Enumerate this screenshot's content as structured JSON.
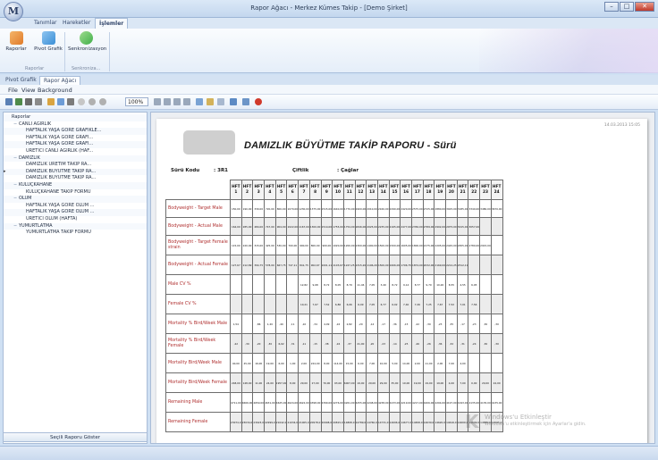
{
  "app": {
    "orb_letter": "M",
    "window_title": "Rapor Ağacı - Merkez Kümes Takip - [Demo Şirket]",
    "win_minimize": "–",
    "win_maximize": "□",
    "win_close": "✕"
  },
  "ribbon": {
    "tabs": [
      {
        "label": "Tanımlar"
      },
      {
        "label": "Hareketler"
      },
      {
        "label": "İşlemler"
      }
    ],
    "buttons": [
      {
        "label": "Raporlar",
        "icon": "report-icon",
        "color": "#e07b2a"
      },
      {
        "label": "Pivot Grafik",
        "icon": "pivot-chart-icon",
        "color": "#3b8fd6"
      },
      {
        "label": "Senkronizasyon",
        "icon": "sync-icon",
        "color": "#3fae49"
      }
    ],
    "groups": [
      {
        "label": "Raporlar"
      },
      {
        "label": "Senkroniza..."
      }
    ]
  },
  "workspace_tabs": [
    {
      "label": "Pivot Grafik"
    },
    {
      "label": "Rapor Ağacı"
    }
  ],
  "menu": {
    "items": [
      {
        "label": "File"
      },
      {
        "label": "View"
      },
      {
        "label": "Background"
      }
    ]
  },
  "toolbar": {
    "zoom_value": "100%"
  },
  "tree": {
    "items": [
      {
        "label": "Raporlar",
        "level": 0,
        "toggle": ""
      },
      {
        "label": "CANLI AĞIRLIK",
        "level": 1,
        "toggle": "−"
      },
      {
        "label": "HAFTALIK YAŞA GÖRE GRAFİKLE...",
        "level": 2,
        "toggle": ""
      },
      {
        "label": "HAFTALIK YAŞA GÖRE GRAFİ...",
        "level": 2,
        "toggle": ""
      },
      {
        "label": "HAFTALIK YAŞA GÖRE GRAFİ...",
        "level": 2,
        "toggle": ""
      },
      {
        "label": "ÜRETİCİ CANLI AĞIRLIK (HAF...",
        "level": 2,
        "toggle": ""
      },
      {
        "label": "DAMIZLIK",
        "level": 1,
        "toggle": "−"
      },
      {
        "label": "DAMIZLIK ÜRETİM TAKİP RA...",
        "level": 2,
        "toggle": ""
      },
      {
        "label": "DAMIZLIK BÜYÜTME TAKİP RA...",
        "level": 2,
        "toggle": ""
      },
      {
        "label": "DAMIZLIK BÜYÜTME TAKİP RA...",
        "level": 2,
        "toggle": ""
      },
      {
        "label": "KULUÇKAHANE",
        "level": 1,
        "toggle": "−"
      },
      {
        "label": "KULUÇKAHANE TAKİP FORMU",
        "level": 2,
        "toggle": ""
      },
      {
        "label": "ÖLÜM",
        "level": 1,
        "toggle": "−"
      },
      {
        "label": "HAFTALIK YAŞA GÖRE ÖLÜM ...",
        "level": 2,
        "toggle": ""
      },
      {
        "label": "HAFTALIK YAŞA GÖRE ÖLÜM ...",
        "level": 2,
        "toggle": ""
      },
      {
        "label": "ÜRETİCİ ÖLÜM (HAFTA)",
        "level": 2,
        "toggle": ""
      },
      {
        "label": "YUMURTLATMA",
        "level": 1,
        "toggle": "−"
      },
      {
        "label": "YUMURTLATMA TAKİP FORMU",
        "level": 2,
        "toggle": ""
      }
    ],
    "row_marker": "▸",
    "show_button": "Seçili Raporu Göster"
  },
  "report": {
    "print_date": "14.03.2013 15:05",
    "title": "DAMIZLIK BÜYÜTME TAKİP RAPORU - Sürü",
    "suru_kodu_label": "Sürü Kodu",
    "suru_kodu_value": ": 3R1",
    "ciftlik_label": "Çiftlik",
    "ciftlik_value": ": Çağlar",
    "week_prefix": "HFT",
    "weeks": [
      "1",
      "2",
      "3",
      "4",
      "5",
      "6",
      "7",
      "8",
      "9",
      "10",
      "11",
      "12",
      "13",
      "14",
      "15",
      "16",
      "17",
      "18",
      "19",
      "20",
      "21",
      "22",
      "23",
      "24"
    ],
    "rows": [
      {
        "label": "Bodyweight - Target Male",
        "values": [
          "150,00",
          "190,00",
          "330,00",
          "720,00",
          "800,00",
          "1070,00",
          "1230,00",
          "1375,00",
          "1515,00",
          "1640,00",
          "1770,00",
          "1900,00",
          "2010,00",
          "2160,00",
          "2290,00",
          "2420,00",
          "2575,00",
          "2725,00",
          "2880,00",
          "3025,00",
          "3185,00",
          "3340,00",
          "3480,00",
          "3670,00"
        ]
      },
      {
        "label": "Bodyweight - Actual Male",
        "values": [
          "164,00",
          "285,00",
          "484,00",
          "747,00",
          "904,00",
          "1022,00",
          "1167,00",
          "1300,00",
          "1514,00",
          "1755,00",
          "1754,00",
          "1846,00",
          "2025,00",
          "2235,00",
          "2165,00",
          "2477,00",
          "2356,00",
          "2789,00",
          "2902,00",
          "2975,00",
          "3015,00",
          "3057,00",
          "",
          ""
        ]
      },
      {
        "label": "Bodyweight - Target Female strain",
        "values": [
          "115,00",
          "220,00",
          "315,00",
          "425,00",
          "530,00",
          "700,00",
          "900,00",
          "800,00",
          "900,00",
          "1020,00",
          "1200,00",
          "1300,00",
          "1400,00",
          "1500,00",
          "1500,00",
          "1605,00",
          "1800,00",
          "2175,00",
          "2205,00",
          "2445,00",
          "2655,00",
          "2780,00",
          "2915,00",
          ""
        ]
      },
      {
        "label": "Bodyweight - Actual Female",
        "values": [
          "127,67",
          "212,89",
          "394,75",
          "578,00",
          "667,75",
          "747,11",
          "841,75",
          "902,67",
          "1001,11",
          "1103,67",
          "1247,25",
          "1315,20",
          "1196,20",
          "1500,00",
          "1606,00",
          "1796,75",
          "1874,00",
          "2032,00",
          "2169,00",
          "2212,25",
          "2512,11",
          "",
          "",
          ""
        ]
      },
      {
        "label": "Male CV %",
        "values": [
          "",
          "",
          "",
          "",
          "",
          "",
          "12,82",
          "9,68",
          "8,72",
          "8,05",
          "8,79",
          "11,46",
          "7,05",
          "3,40",
          "8,72",
          "9,14",
          "8,77",
          "9,79",
          "10,26",
          "8,55",
          "4,55",
          "6,05",
          "",
          ""
        ]
      },
      {
        "label": "Female CV %",
        "values": [
          "",
          "",
          "",
          "",
          "",
          "",
          "10,21",
          "7,67",
          "7,52",
          "6,86",
          "6,06",
          "6,09",
          "7,05",
          "6,77",
          "6,02",
          "7,40",
          "7,26",
          "7,25",
          "7,67",
          "7,52",
          "7,01",
          "7,56",
          "",
          ""
        ]
      },
      {
        "label": "Mortality % Bird/Week Male",
        "values": [
          "1,54",
          "",
          ",86",
          "1,20",
          ",40",
          ",11",
          ",10",
          ",34",
          "4,09",
          ",16",
          "2,82",
          ",20",
          ",14",
          ",17",
          ",36",
          ",15",
          ",22",
          ",30",
          ",23",
          ",35",
          ",17",
          ",23",
          ",30",
          ",30"
        ]
      },
      {
        "label": "Mortality % Bird/Week Female",
        "values": [
          ",22",
          ",30",
          ",20",
          ",30",
          "6,02",
          ",31",
          ",11",
          ",15",
          ",38",
          ",16",
          ",37",
          "21,00",
          ",20",
          ",23",
          ",14",
          ",25",
          ",26",
          ",26",
          ",36",
          ",32",
          ",31",
          ",24",
          ",30",
          ",30"
        ]
      },
      {
        "label": "Mortality Bird/Week Male",
        "values": [
          "40,00",
          "45,00",
          "16,00",
          "19,00",
          "6,00",
          "1,00",
          "2,00",
          "224,00",
          "8,00",
          "114,00",
          "15,00",
          "6,00",
          "7,00",
          "10,00",
          "5,00",
          "14,00",
          "2,00",
          "11,00",
          "2,00",
          "7,00",
          "4,00",
          "",
          "",
          ""
        ]
      },
      {
        "label": "Mortality Bird/Week Female",
        "values": [
          "248,00",
          "148,00",
          "11,00",
          "24,00",
          "1957,00",
          "8,00",
          "29,00",
          "27,00",
          "70,00",
          "93,00",
          "6007,00",
          "19,00",
          "29,00",
          "29,00",
          "35,00",
          "19,00",
          "19,00",
          "19,00",
          "19,00",
          "4,00",
          "7,00",
          "0,00",
          "20,00",
          "24,00"
        ]
      },
      {
        "label": "Remaining Male",
        "values": [
          "4711,00",
          "4666,00",
          "4650,00",
          "4631,00",
          "4625,00",
          "4624,00",
          "4622,00",
          "4398,00",
          "4390,00",
          "4276,00",
          "4261,00",
          "4255,00",
          "4248,00",
          "4238,00",
          "4233,00",
          "4219,00",
          "4217,00",
          "4206,00",
          "4204,00",
          "4197,00",
          "4193,00",
          "4135,00",
          "4135,00",
          "4135,00"
        ]
      },
      {
        "label": "Remaining Female",
        "values": [
          "23074,0",
          "23034,0",
          "23023,0",
          "22999,0",
          "21042,0",
          "21034,0",
          "21005,0",
          "20978,0",
          "20908,0",
          "20815,0",
          "14808,0",
          "14789,0",
          "14760,0",
          "14731,0",
          "14696,0",
          "14677,0",
          "14658,0",
          "14639,0",
          "14620,0",
          "14616,0",
          "14609,0",
          "14609,0",
          "14589,0",
          "14565,0"
        ]
      }
    ]
  },
  "status": {
    "left": "",
    "right": ""
  },
  "watermark": {
    "letter": "K",
    "title": "Windows'u Etkinleştir",
    "subtitle": "Windows'u etkinleştirmek için Ayarlar'a gidin."
  }
}
